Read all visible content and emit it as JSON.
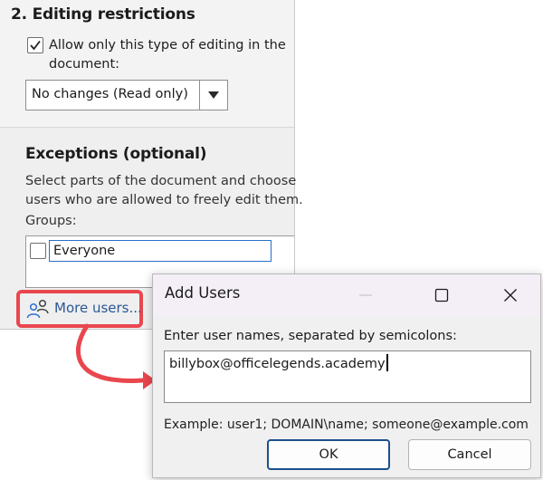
{
  "pane": {
    "section_title": "2. Editing restrictions",
    "allow_checked": true,
    "allow_line1": "Allow only this type of editing in the",
    "allow_line2": "document:",
    "editing_type": "No changes (Read only)",
    "exceptions_title": "Exceptions (optional)",
    "exceptions_line1": "Select parts of the document and choose",
    "exceptions_line2": "users who are allowed to freely edit them.",
    "groups_label": "Groups:",
    "groups": [
      {
        "label": "Everyone",
        "checked": false
      }
    ],
    "more_users_link": "More users..."
  },
  "dialog": {
    "title": "Add Users",
    "prompt": "Enter user names, separated by semicolons:",
    "names_value": "billybox@officelegends.academy",
    "example": "Example: user1; DOMAIN\\name; someone@example.com",
    "ok_label": "OK",
    "cancel_label": "Cancel"
  },
  "icons": {
    "checkbox_check": "checkmark-icon",
    "dropdown": "chevron-down-icon",
    "more_users": "people-icon",
    "minimize": "minimize-icon",
    "maximize": "maximize-icon",
    "close": "close-icon",
    "callout": "curved-arrow-icon"
  },
  "colors": {
    "highlight": "#e8474e",
    "link": "#2b5797",
    "focus_border": "#2a6fc9",
    "default_button_border": "#1c4f8c"
  }
}
